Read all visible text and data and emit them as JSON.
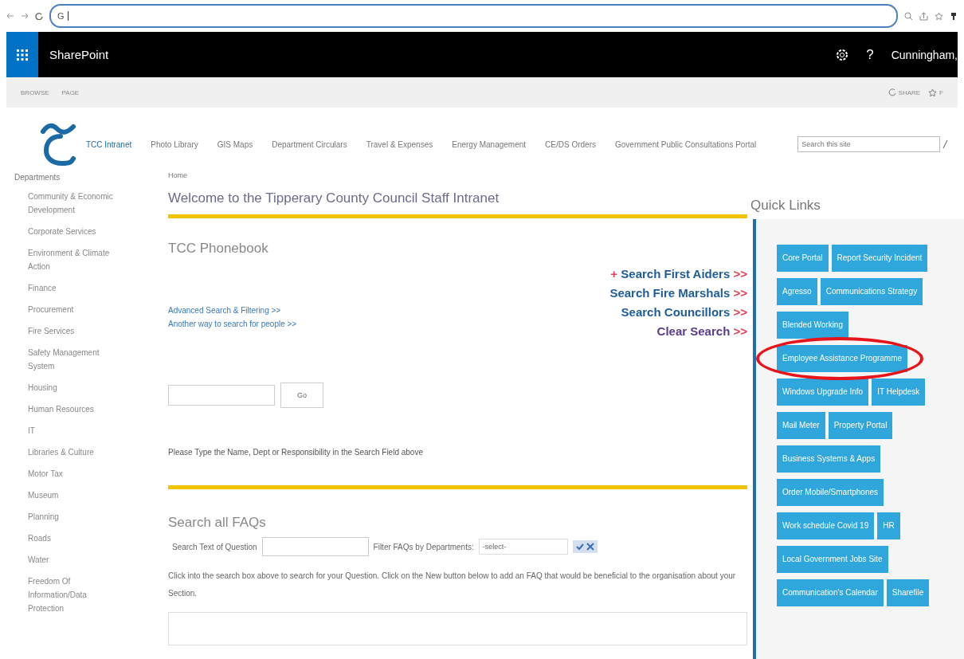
{
  "browser": {
    "address": "G"
  },
  "suite_bar": {
    "app_name": "SharePoint",
    "help": "?",
    "user": "Cunningham,"
  },
  "ribbon": {
    "tabs": [
      {
        "label": "BROWSE",
        "selected": false
      },
      {
        "label": "PAGE",
        "selected": false
      }
    ],
    "actions": [
      "SHARE",
      "F"
    ]
  },
  "top_nav": {
    "items": [
      {
        "label": "TCC Intranet",
        "selected": true
      },
      {
        "label": "Photo Library",
        "selected": false
      },
      {
        "label": "GIS Maps",
        "selected": false
      },
      {
        "label": "Department Circulars",
        "selected": false
      },
      {
        "label": "Travel & Expenses",
        "selected": false
      },
      {
        "label": "Energy Management",
        "selected": false
      },
      {
        "label": "CE/DS Orders",
        "selected": false
      },
      {
        "label": "Government Public Consultations Portal",
        "selected": false
      }
    ],
    "search": {
      "placeholder": "Search this site"
    }
  },
  "sidebar": {
    "heading": "Departments",
    "items": [
      "Community & Economic Development",
      "Corporate Services",
      "Environment & Climate Action",
      "Finance",
      "Procurement",
      "Fire Services",
      "Safety Management System",
      "Housing",
      "Human Resources",
      "IT",
      "Libraries & Culture",
      "Motor Tax",
      "Museum",
      "Planning",
      "Roads",
      "Water",
      "Freedom Of Information/Data Protection"
    ]
  },
  "breadcrumb": "Home",
  "welcome_title": "Welcome to the Tipperary County Council Staff Intranet",
  "phonebook": {
    "title": "TCC Phonebook",
    "links": [
      "Advanced Search & Filtering >>",
      "Another way to search for people >>"
    ],
    "search_links": [
      {
        "prefix": "+",
        "label": "Search First Aiders",
        "arrows": ">>",
        "color": "#1f5c99"
      },
      {
        "label": "Search Fire Marshals",
        "arrows": ">>",
        "color": "#1f5c99"
      },
      {
        "label": "Search Councillors",
        "arrows": ">>",
        "color": "#1f5c99"
      },
      {
        "label": "Clear Search",
        "arrows": ">>",
        "color": "#5a3b8c"
      }
    ],
    "button": "Go",
    "hint": "Please Type the Name, Dept or Responsibility in the Search Field above"
  },
  "faqs": {
    "title": "Search all FAQs",
    "search_label": "Search Text of Question",
    "filter_label": "Filter FAQs by Departments:",
    "filter_value": "-select-",
    "description": "Click into the search box above to search for your Question.  Click on the New button below to add an FAQ that would be beneficial to the organisation about your Section."
  },
  "quick_links": {
    "title": "Quick Links",
    "rows": [
      [
        {
          "label": "Core Portal",
          "circled": false
        },
        {
          "label": "Report Security Incident",
          "circled": false
        }
      ],
      [
        {
          "label": "Agresso",
          "circled": false
        },
        {
          "label": "Communications Strategy",
          "circled": false
        }
      ],
      [
        {
          "label": "Blended Working",
          "circled": false
        }
      ],
      [
        {
          "label": "Employee Assistance Programme",
          "circled": true
        }
      ],
      [
        {
          "label": "Windows Upgrade Info",
          "circled": false
        },
        {
          "label": "IT Helpdesk",
          "circled": false
        }
      ],
      [
        {
          "label": "Mail Meter",
          "circled": false
        },
        {
          "label": "Property Portal",
          "circled": false
        }
      ],
      [
        {
          "label": "Business Systems & Apps",
          "circled": false
        }
      ],
      [
        {
          "label": "Order Mobile/Smartphones",
          "circled": false
        }
      ],
      [
        {
          "label": "Work schedule Covid 19",
          "circled": false
        },
        {
          "label": "HR",
          "circled": false
        }
      ],
      [
        {
          "label": "Local Government Jobs Site",
          "circled": false
        }
      ],
      [
        {
          "label": "Communication's Calendar",
          "circled": false
        },
        {
          "label": "Sharefile",
          "circled": false
        }
      ]
    ]
  }
}
